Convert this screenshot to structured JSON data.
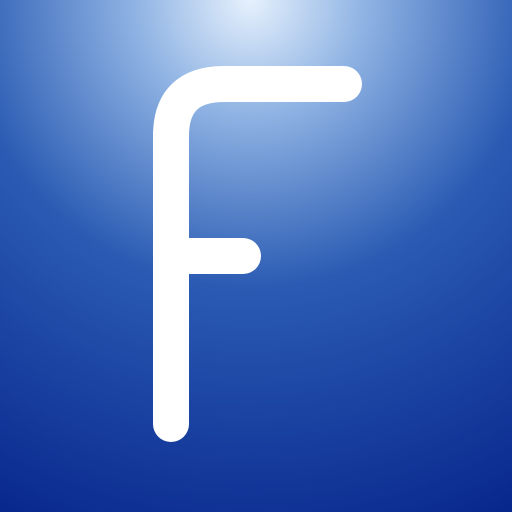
{
  "icon": {
    "glyph": "F",
    "glyph_icon": "letter-f-icon",
    "colors": {
      "highlight": "#e6f1fd",
      "mid": "#2a5bb3",
      "deep": "#001a84",
      "glyph": "#ffffff"
    }
  }
}
